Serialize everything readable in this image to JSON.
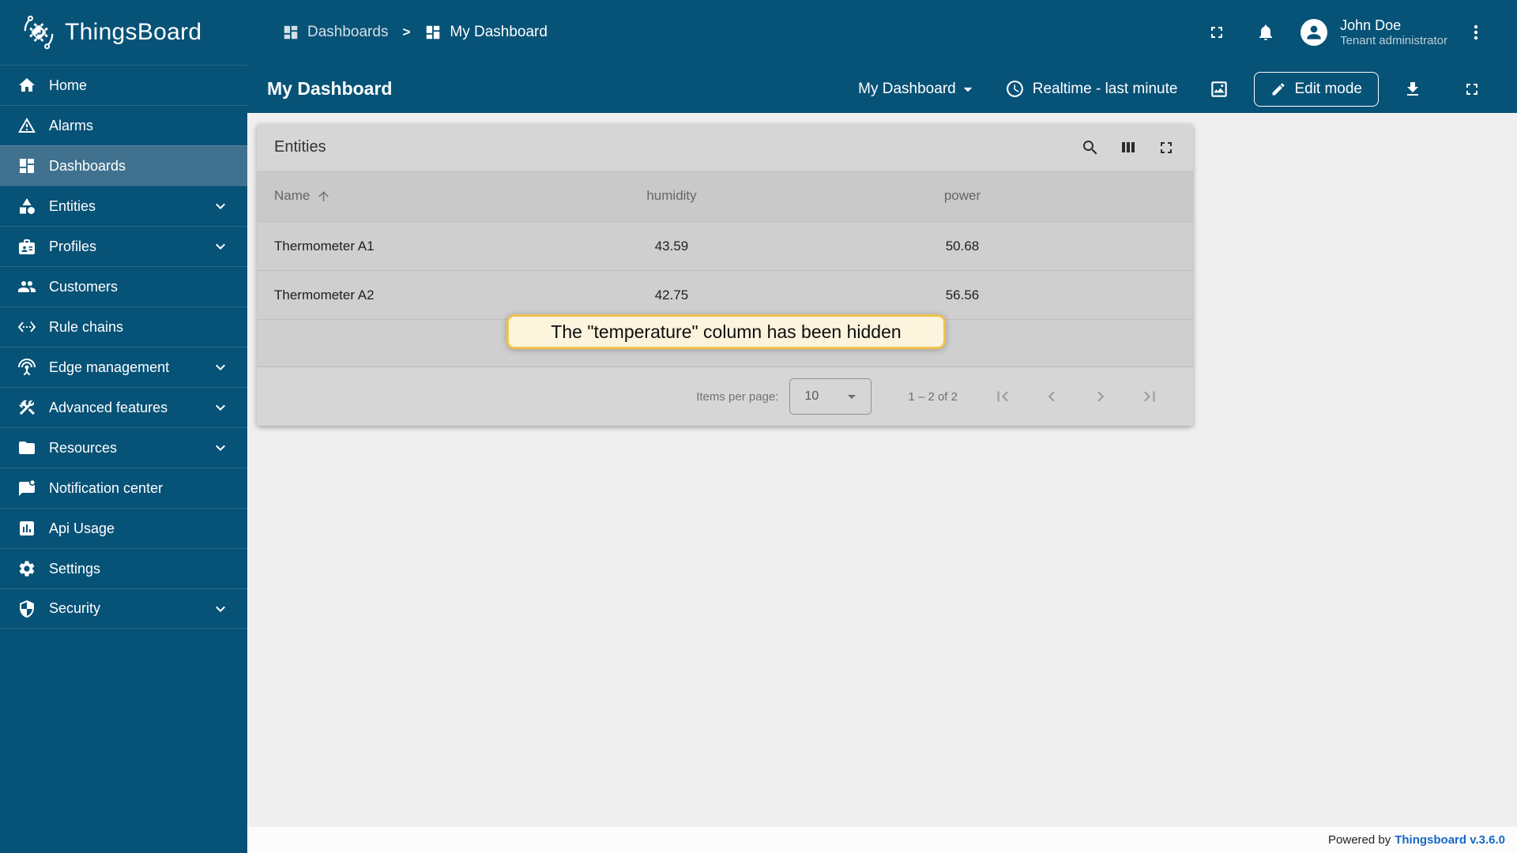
{
  "brand": {
    "name": "ThingsBoard"
  },
  "sidebar": {
    "items": [
      {
        "label": "Home",
        "icon": "home-icon",
        "selected": false,
        "expandable": false
      },
      {
        "label": "Alarms",
        "icon": "alarm-warning-icon",
        "selected": false,
        "expandable": false
      },
      {
        "label": "Dashboards",
        "icon": "dashboards-grid-icon",
        "selected": true,
        "expandable": false
      },
      {
        "label": "Entities",
        "icon": "entities-category-icon",
        "selected": false,
        "expandable": true
      },
      {
        "label": "Profiles",
        "icon": "profiles-badge-icon",
        "selected": false,
        "expandable": true
      },
      {
        "label": "Customers",
        "icon": "customers-people-icon",
        "selected": false,
        "expandable": false
      },
      {
        "label": "Rule chains",
        "icon": "rule-chains-icon",
        "selected": false,
        "expandable": false
      },
      {
        "label": "Edge management",
        "icon": "edge-antenna-icon",
        "selected": false,
        "expandable": true
      },
      {
        "label": "Advanced features",
        "icon": "advanced-tools-icon",
        "selected": false,
        "expandable": true
      },
      {
        "label": "Resources",
        "icon": "resources-folder-icon",
        "selected": false,
        "expandable": true
      },
      {
        "label": "Notification center",
        "icon": "notification-message-icon",
        "selected": false,
        "expandable": false
      },
      {
        "label": "Api Usage",
        "icon": "api-usage-chart-icon",
        "selected": false,
        "expandable": false
      },
      {
        "label": "Settings",
        "icon": "settings-gear-icon",
        "selected": false,
        "expandable": false
      },
      {
        "label": "Security",
        "icon": "security-shield-icon",
        "selected": false,
        "expandable": true
      }
    ]
  },
  "breadcrumb": {
    "separator": ">",
    "items": [
      {
        "label": "Dashboards"
      },
      {
        "label": "My Dashboard"
      }
    ]
  },
  "user": {
    "name": "John Doe",
    "role": "Tenant administrator"
  },
  "toolbar": {
    "title": "My Dashboard",
    "state_select_value": "My Dashboard",
    "time_window": "Realtime - last minute",
    "edit_button_label": "Edit mode"
  },
  "widget": {
    "title": "Entities",
    "table": {
      "columns": [
        "Name",
        "humidity",
        "power"
      ],
      "sorted_column": "Name",
      "sort_direction": "asc",
      "rows": [
        {
          "name": "Thermometer A1",
          "humidity": "43.59",
          "power": "50.68"
        },
        {
          "name": "Thermometer A2",
          "humidity": "42.75",
          "power": "56.56"
        }
      ]
    },
    "callout_text": "The \"temperature\" column has been hidden",
    "paginator": {
      "items_per_page_label": "Items per page:",
      "page_size_value": "10",
      "range_label": "1 – 2 of 2"
    }
  },
  "footer": {
    "powered_by": "Powered by",
    "version_link": "Thingsboard v.3.6.0"
  },
  "colors": {
    "primary_blue": "#075277",
    "selected_item_blue": "#40718f",
    "content_background": "#efefef",
    "card_background": "#d6d6d6",
    "table_header_background": "#c9c9c9",
    "callout_border": "#f2c24e",
    "callout_background": "#fdf4dd",
    "version_link_blue": "#1669c5"
  }
}
